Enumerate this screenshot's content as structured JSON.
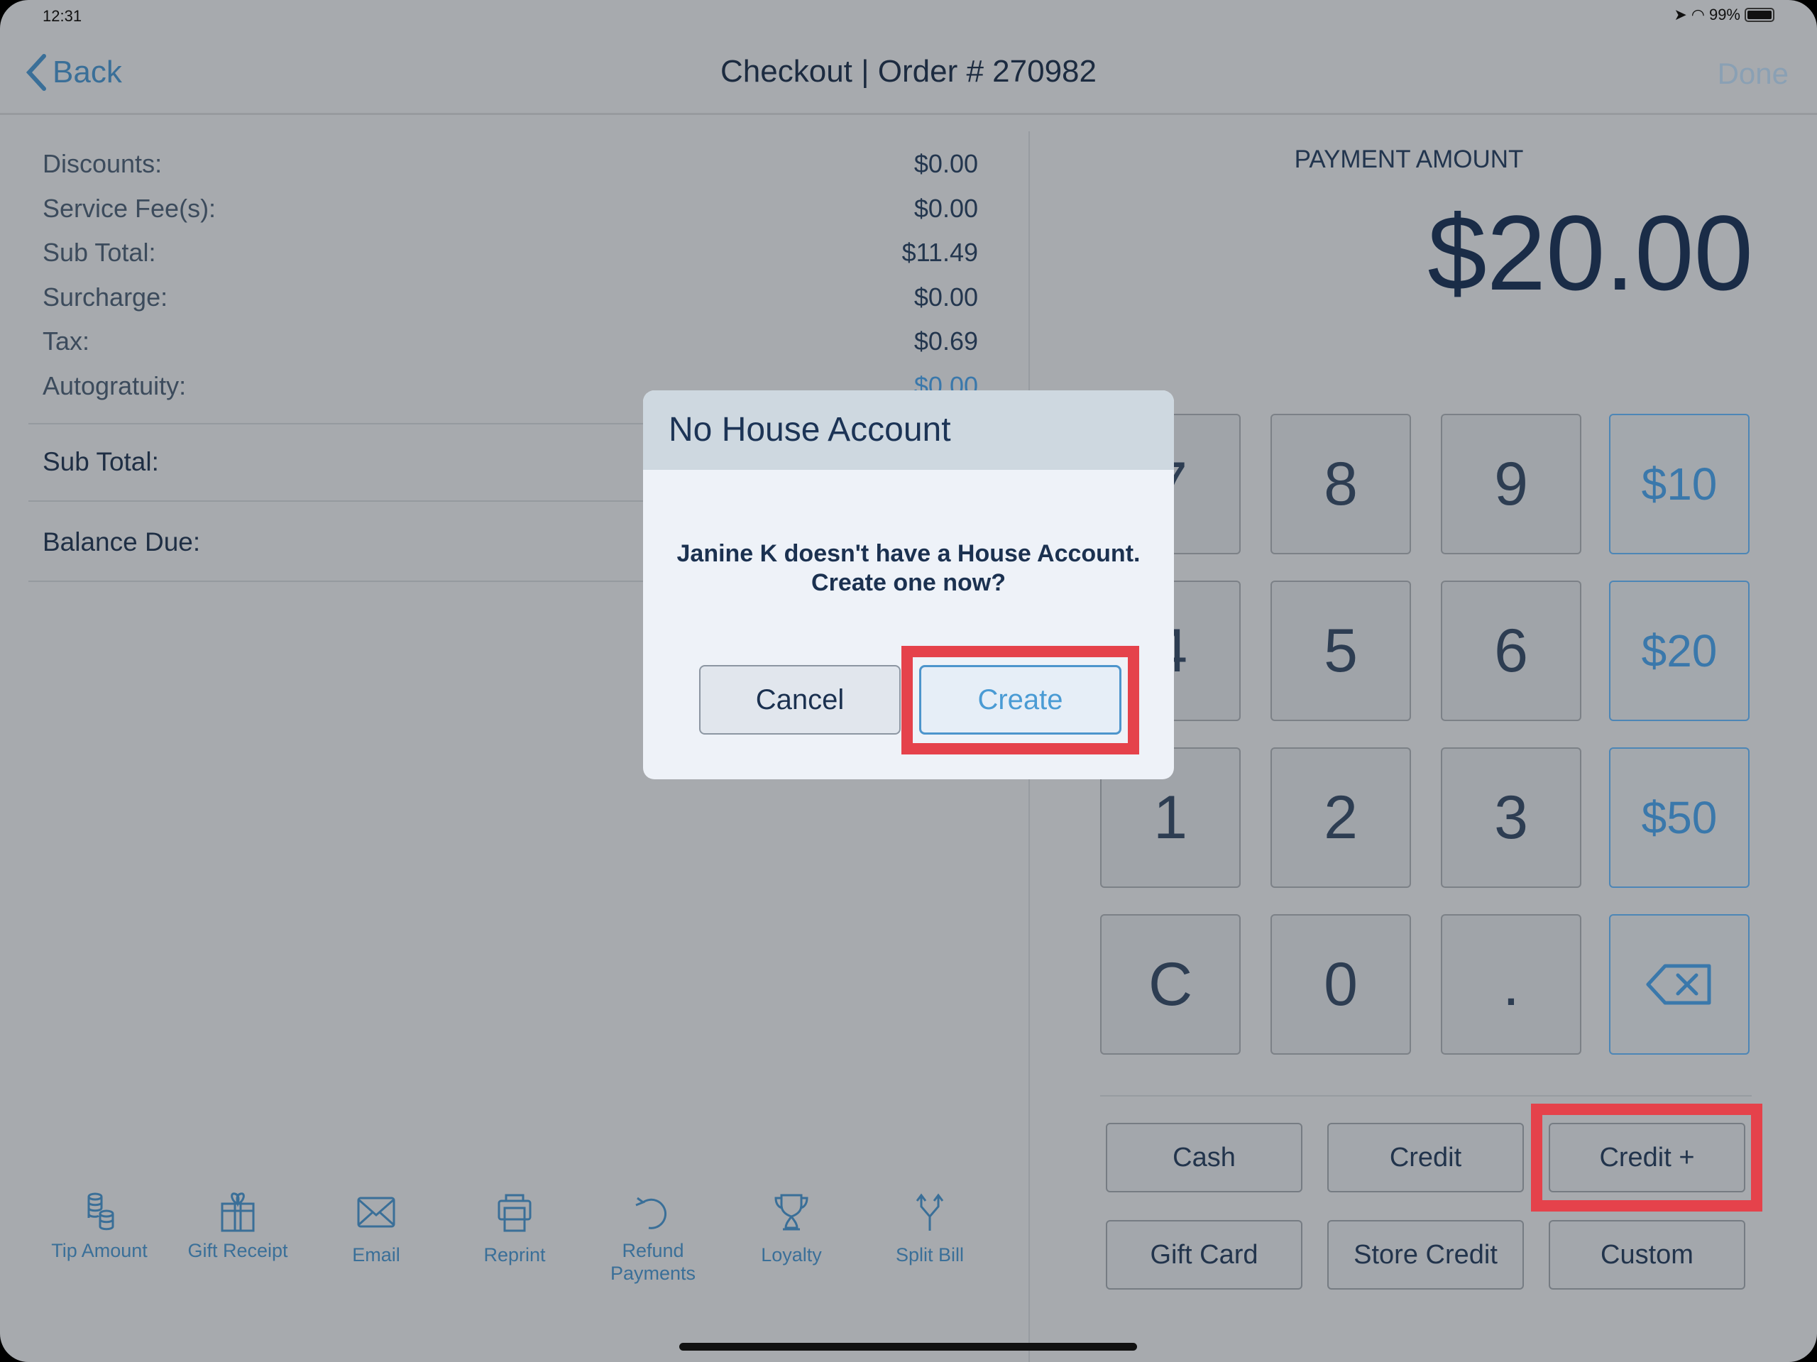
{
  "status_bar": {
    "time": "12:31",
    "battery": "99%"
  },
  "nav": {
    "back_label": "Back",
    "title": "Checkout | Order # 270982",
    "done_label": "Done"
  },
  "summary": {
    "rows": [
      {
        "label": "Discounts:",
        "value": "$0.00"
      },
      {
        "label": "Service Fee(s):",
        "value": "$0.00"
      },
      {
        "label": "Sub Total:",
        "value": "$11.49"
      },
      {
        "label": "Surcharge:",
        "value": "$0.00"
      },
      {
        "label": "Tax:",
        "value": "$0.69"
      },
      {
        "label": "Autogratuity:",
        "value": "$0.00"
      }
    ],
    "subtotal_label": "Sub Total:",
    "balance_label": "Balance Due:"
  },
  "payment": {
    "label": "PAYMENT AMOUNT",
    "amount": "$20.00"
  },
  "keypad": [
    "7",
    "8",
    "9",
    "$10",
    "4",
    "5",
    "6",
    "$20",
    "1",
    "2",
    "3",
    "$50",
    "C",
    "0",
    ".",
    "backspace"
  ],
  "methods": [
    "Cash",
    "Credit",
    "Credit +",
    "Gift Card",
    "Store Credit",
    "Custom"
  ],
  "toolbar": [
    {
      "label": "Tip Amount",
      "icon": "coins-icon"
    },
    {
      "label": "Gift Receipt",
      "icon": "gift-icon"
    },
    {
      "label": "Email",
      "icon": "envelope-icon"
    },
    {
      "label": "Reprint",
      "icon": "printer-icon"
    },
    {
      "label": "Refund Payments",
      "icon": "refund-icon"
    },
    {
      "label": "Loyalty",
      "icon": "trophy-icon"
    },
    {
      "label": "Split Bill",
      "icon": "split-icon"
    }
  ],
  "dialog": {
    "title": "No House Account",
    "message_line1": "Janine K doesn't have a House Account.",
    "message_line2": "Create one now?",
    "cancel_label": "Cancel",
    "create_label": "Create"
  },
  "colors": {
    "accent": "#3a78ab",
    "highlight": "#e5424b",
    "overlay": "#a7aaae"
  }
}
